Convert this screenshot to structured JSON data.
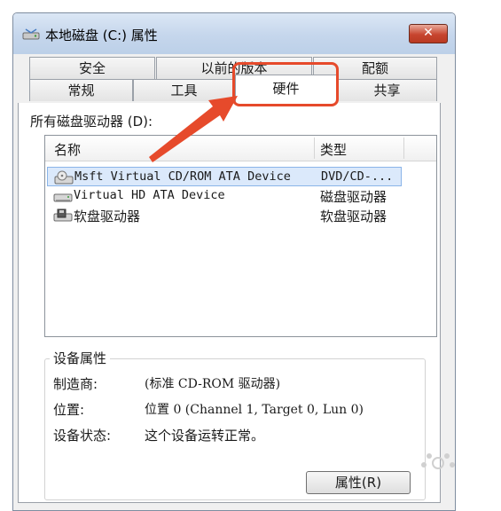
{
  "window": {
    "title": "本地磁盘 (C:) 属性",
    "close_glyph": "✕"
  },
  "tabs_top": [
    {
      "label": "安全"
    },
    {
      "label": "以前的版本"
    },
    {
      "label": "配额"
    }
  ],
  "tabs_bottom": [
    {
      "label": "常规"
    },
    {
      "label": "工具"
    },
    {
      "label": "硬件",
      "selected": true
    },
    {
      "label": "共享"
    }
  ],
  "drives": {
    "label": "所有磁盘驱动器 (D):",
    "columns": {
      "name": "名称",
      "type": "类型"
    },
    "rows": [
      {
        "name": "Msft Virtual CD/ROM ATA Device",
        "type": "DVD/CD-...",
        "icon": "cdrom-icon",
        "selected": true
      },
      {
        "name": "Virtual HD ATA Device",
        "type": "磁盘驱动器",
        "icon": "hard-disk-icon"
      },
      {
        "name": "软盘驱动器",
        "type": "软盘驱动器",
        "icon": "floppy-drive-icon"
      }
    ]
  },
  "device_props": {
    "title": "设备属性",
    "manufacturer_label": "制造商:",
    "manufacturer_value": "(标准 CD-ROM 驱动器)",
    "location_label": "位置:",
    "location_value": "位置 0 (Channel 1, Target 0, Lun 0)",
    "status_label": "设备状态:",
    "status_value": "这个设备运转正常。",
    "properties_button": "属性(R)"
  },
  "colors": {
    "annotation": "#e64a2b",
    "selection": "#dbe9fb"
  }
}
